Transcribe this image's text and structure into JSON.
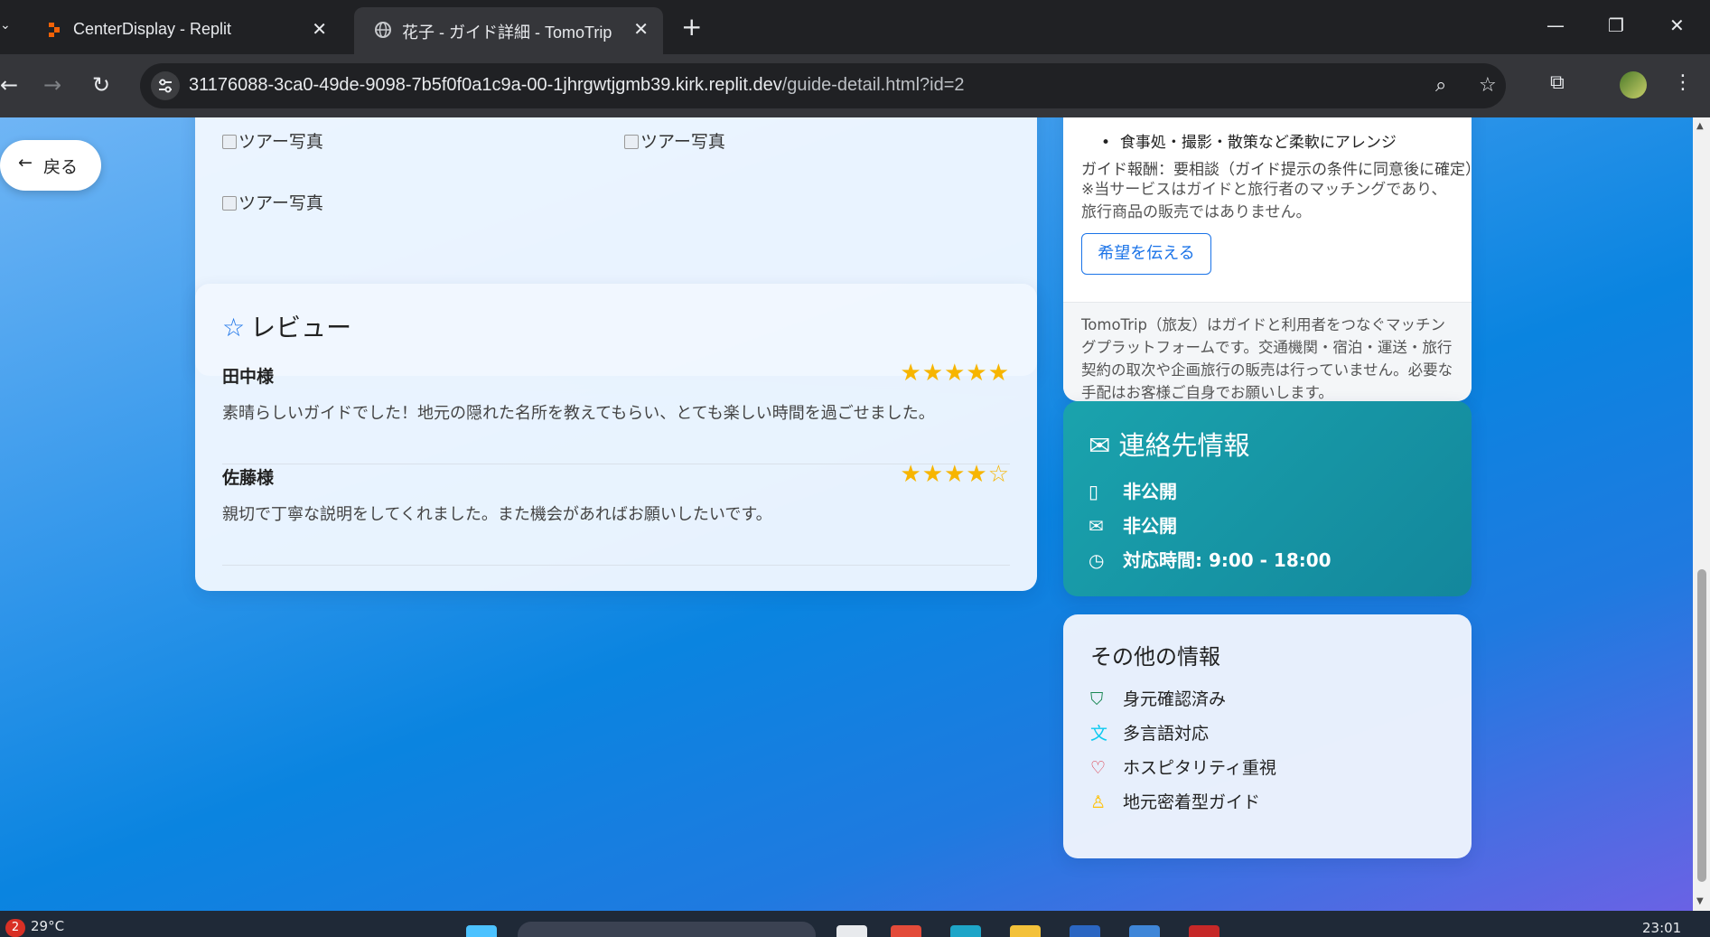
{
  "browser": {
    "tabs": [
      {
        "title": "CenterDisplay - Replit",
        "active": false,
        "favicon": "replit-icon"
      },
      {
        "title": "花子 - ガイド詳細 - TomoTrip",
        "active": true,
        "favicon": "globe-icon"
      }
    ],
    "url_host": "31176088-3ca0-49de-9098-7b5f0f0a1c9a-00-1jhrgwtjgmb39.kirk.replit.dev",
    "url_path": "/guide-detail.html?id=2"
  },
  "page": {
    "back_label": "戻る",
    "photos": [
      "ツアー写真",
      "ツアー写真",
      "ツアー写真"
    ],
    "reviews": {
      "title": "レビュー",
      "items": [
        {
          "name": "田中様",
          "rating": 5,
          "stars": "★★★★★",
          "text": "素晴らしいガイドでした！地元の隠れた名所を教えてもらい、とても楽しい時間を過ごせました。"
        },
        {
          "name": "佐藤様",
          "rating": 4,
          "stars": "★★★★☆",
          "text": "親切で丁寧な説明をしてくれました。また機会があればお願いしたいです。"
        }
      ]
    },
    "booking": {
      "bullet": "食事処・撮影・散策など柔軟にアレンジ",
      "fee": "ガイド報酬：要相談（ガイド提示の条件に同意後に確定）",
      "notice": "※当サービスはガイドと旅行者のマッチングであり、旅行商品の販売ではありません。",
      "wish_button": "希望を伝える",
      "disclaimer": "TomoTrip（旅友）はガイドと利用者をつなぐマッチングプラットフォームです。交通機関・宿泊・運送・旅行契約の取次や企画旅行の販売は行っていません。必要な手配はお客様ご自身でお願いします。"
    },
    "contact": {
      "title": "連絡先情報",
      "phone": "非公開",
      "email": "非公開",
      "hours": "対応時間: 9:00 - 18:00"
    },
    "other": {
      "title": "その他の情報",
      "items": [
        {
          "label": "身元確認済み",
          "icon": "shield-check-icon",
          "color": "#198754"
        },
        {
          "label": "多言語対応",
          "icon": "translate-icon",
          "color": "#0dcaf0"
        },
        {
          "label": "ホスピタリティ重視",
          "icon": "heart-icon",
          "color": "#dc3545"
        },
        {
          "label": "地元密着型ガイド",
          "icon": "award-icon",
          "color": "#ffc107"
        }
      ]
    }
  },
  "taskbar": {
    "notification_count": "2",
    "temperature": "29°C",
    "time": "23:01"
  },
  "colors": {
    "accent": "#1a73e8",
    "star": "#f7b500",
    "contact_bg": "#13879c"
  }
}
